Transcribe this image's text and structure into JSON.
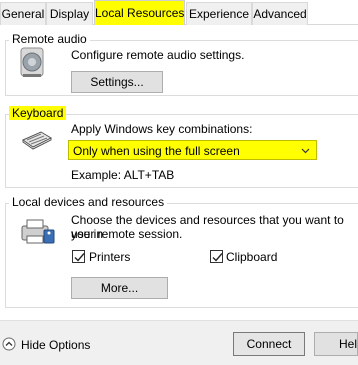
{
  "tabs": [
    "General",
    "Display",
    "Local Resources",
    "Experience",
    "Advanced"
  ],
  "remote_audio": {
    "title": "Remote audio",
    "description": "Configure remote audio settings.",
    "settings_button": "Settings..."
  },
  "keyboard": {
    "title": "Keyboard",
    "description": "Apply Windows key combinations:",
    "selected_option": "Only when using the full screen",
    "example": "Example: ALT+TAB"
  },
  "local_devices": {
    "title": "Local devices and resources",
    "description_line1": "Choose the devices and resources that you want to use in",
    "description_line2": "your remote session.",
    "printers_label": "Printers",
    "printers_checked": true,
    "clipboard_label": "Clipboard",
    "clipboard_checked": true,
    "more_button": "More..."
  },
  "footer": {
    "hide_options": "Hide Options",
    "connect_button": "Connect",
    "help_button": "Help"
  },
  "colors": {
    "highlight": "#ffff00",
    "border": "#dcdcdc",
    "footer_bg": "#f0f0f0"
  },
  "icons": [
    "speaker-icon",
    "keyboard-icon",
    "devices-icon",
    "chevron-down-icon",
    "collapse-up-icon"
  ]
}
